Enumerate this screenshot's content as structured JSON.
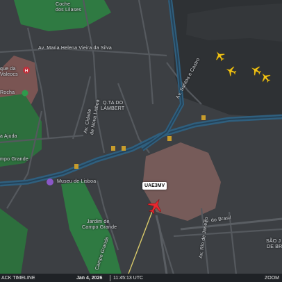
{
  "map": {
    "labels": {
      "coche_line1": "Coche",
      "coche_line2": "dos Lilases",
      "maria_helena": "Av. Maria Helena Vieira da Silva",
      "parque": "que da",
      "valeocs": "Valeocs",
      "rocha": "Rocha",
      "ajuda": "a Ajuda",
      "campo_grande_left": "mpo Grande",
      "qta_line1": "Q.TA DO",
      "qta_line2": "LAMBERT",
      "santos": "Av. Santos e Castro",
      "cidade_line1": "Av. Cidade",
      "cidade_line2": "de Nova Lisboa",
      "museu": "Museu de Lisboa",
      "jardim_line1": "Jardim de",
      "jardim_line2": "Campo Grande",
      "campo_grande_av": "Campo Grande",
      "av_brasil": "Av. do Brasil",
      "av_rio": "Av. Rio de Janeiro",
      "sao_line1": "SÃO J",
      "sao_line2": "DE BR"
    },
    "flight_tag": "UAE3MV",
    "colors": {
      "tracked_aircraft": "#e8282f",
      "other_aircraft": "#f2c316",
      "flight_path": "#d8c96a",
      "park": "#2f7a42",
      "airport_area": "#8a6660",
      "highway": "#2f5f7e"
    }
  },
  "timeline": {
    "label": "ACK TIMELINE",
    "date": "Jan 4, 2026",
    "time": "11:45:13 UTC",
    "zoom": "ZOOM"
  },
  "icons": {
    "tracked": "airplane-icon",
    "traffic": "airplane-icon",
    "museum": "museum-pin-icon",
    "hospital": "hospital-pin-icon",
    "park": "park-pin-icon",
    "road_shield": "road-shield-icon"
  }
}
